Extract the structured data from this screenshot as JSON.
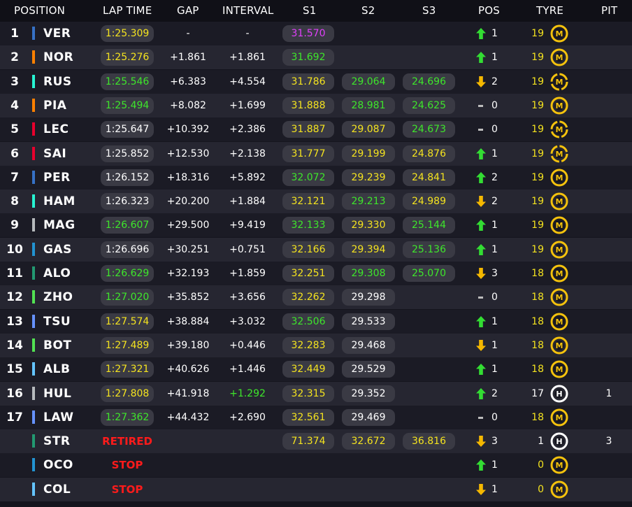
{
  "colors": {
    "purple": "#e040fb",
    "green": "#3ee62b",
    "yellow": "#f4e31f",
    "white": "#ffffff",
    "retired": "#ff1b1b",
    "arrow_up": "#33dd33",
    "arrow_down": "#f5b800",
    "tyre_medium": "#f4c20d",
    "tyre_hard": "#ffffff"
  },
  "headers": {
    "position": "POSITION",
    "lap_time": "LAP TIME",
    "gap": "GAP",
    "interval": "INTERVAL",
    "s1": "S1",
    "s2": "S2",
    "s3": "S3",
    "pos": "POS",
    "tyre": "TYRE",
    "pit": "PIT"
  },
  "drivers": [
    {
      "position": "1",
      "code": "VER",
      "team_color": "#3671c6",
      "lap_time": "1:25.309",
      "lap_color": "yellow",
      "gap": "-",
      "interval": "-",
      "interval_color": "white",
      "s1": "31.570",
      "s1_color": "purple",
      "s2": "",
      "s2_color": "white",
      "s3": "",
      "s3_color": "white",
      "status": "",
      "pos_change": "up",
      "pos_value": "1",
      "tyre_laps": "19",
      "tyre_laps_color": "yellow",
      "tyre": "M",
      "tyre_icon": "medium-tyre-icon",
      "pit": ""
    },
    {
      "position": "2",
      "code": "NOR",
      "team_color": "#ff8000",
      "lap_time": "1:25.276",
      "lap_color": "yellow",
      "gap": "+1.861",
      "interval": "+1.861",
      "interval_color": "white",
      "s1": "31.692",
      "s1_color": "green",
      "s2": "",
      "s2_color": "white",
      "s3": "",
      "s3_color": "white",
      "status": "",
      "pos_change": "up",
      "pos_value": "1",
      "tyre_laps": "19",
      "tyre_laps_color": "yellow",
      "tyre": "M",
      "tyre_icon": "medium-tyre-icon",
      "pit": ""
    },
    {
      "position": "3",
      "code": "RUS",
      "team_color": "#27f4d2",
      "lap_time": "1:25.546",
      "lap_color": "green",
      "gap": "+6.383",
      "interval": "+4.554",
      "interval_color": "white",
      "s1": "31.786",
      "s1_color": "yellow",
      "s2": "29.064",
      "s2_color": "green",
      "s3": "24.696",
      "s3_color": "green",
      "status": "",
      "pos_change": "down",
      "pos_value": "2",
      "tyre_laps": "19",
      "tyre_laps_color": "yellow",
      "tyre": "M",
      "tyre_icon": "medium-tyre-pitting-icon",
      "pit": ""
    },
    {
      "position": "4",
      "code": "PIA",
      "team_color": "#ff8000",
      "lap_time": "1:25.494",
      "lap_color": "green",
      "gap": "+8.082",
      "interval": "+1.699",
      "interval_color": "white",
      "s1": "31.888",
      "s1_color": "yellow",
      "s2": "28.981",
      "s2_color": "green",
      "s3": "24.625",
      "s3_color": "green",
      "status": "",
      "pos_change": "none",
      "pos_value": "0",
      "tyre_laps": "19",
      "tyre_laps_color": "yellow",
      "tyre": "M",
      "tyre_icon": "medium-tyre-icon",
      "pit": ""
    },
    {
      "position": "5",
      "code": "LEC",
      "team_color": "#e8002d",
      "lap_time": "1:25.647",
      "lap_color": "white",
      "gap": "+10.392",
      "interval": "+2.386",
      "interval_color": "white",
      "s1": "31.887",
      "s1_color": "yellow",
      "s2": "29.087",
      "s2_color": "yellow",
      "s3": "24.673",
      "s3_color": "green",
      "status": "",
      "pos_change": "none",
      "pos_value": "0",
      "tyre_laps": "19",
      "tyre_laps_color": "yellow",
      "tyre": "M",
      "tyre_icon": "medium-tyre-pitting-icon",
      "pit": ""
    },
    {
      "position": "6",
      "code": "SAI",
      "team_color": "#e8002d",
      "lap_time": "1:25.852",
      "lap_color": "white",
      "gap": "+12.530",
      "interval": "+2.138",
      "interval_color": "white",
      "s1": "31.777",
      "s1_color": "yellow",
      "s2": "29.199",
      "s2_color": "yellow",
      "s3": "24.876",
      "s3_color": "yellow",
      "status": "",
      "pos_change": "up",
      "pos_value": "1",
      "tyre_laps": "19",
      "tyre_laps_color": "yellow",
      "tyre": "M",
      "tyre_icon": "medium-tyre-pitting-icon",
      "pit": ""
    },
    {
      "position": "7",
      "code": "PER",
      "team_color": "#3671c6",
      "lap_time": "1:26.152",
      "lap_color": "white",
      "gap": "+18.316",
      "interval": "+5.892",
      "interval_color": "white",
      "s1": "32.072",
      "s1_color": "green",
      "s2": "29.239",
      "s2_color": "yellow",
      "s3": "24.841",
      "s3_color": "yellow",
      "status": "",
      "pos_change": "up",
      "pos_value": "2",
      "tyre_laps": "19",
      "tyre_laps_color": "yellow",
      "tyre": "M",
      "tyre_icon": "medium-tyre-icon",
      "pit": ""
    },
    {
      "position": "8",
      "code": "HAM",
      "team_color": "#27f4d2",
      "lap_time": "1:26.323",
      "lap_color": "white",
      "gap": "+20.200",
      "interval": "+1.884",
      "interval_color": "white",
      "s1": "32.121",
      "s1_color": "yellow",
      "s2": "29.213",
      "s2_color": "green",
      "s3": "24.989",
      "s3_color": "yellow",
      "status": "",
      "pos_change": "down",
      "pos_value": "2",
      "tyre_laps": "19",
      "tyre_laps_color": "yellow",
      "tyre": "M",
      "tyre_icon": "medium-tyre-icon",
      "pit": ""
    },
    {
      "position": "9",
      "code": "MAG",
      "team_color": "#b6babd",
      "lap_time": "1:26.607",
      "lap_color": "green",
      "gap": "+29.500",
      "interval": "+9.419",
      "interval_color": "white",
      "s1": "32.133",
      "s1_color": "green",
      "s2": "29.330",
      "s2_color": "yellow",
      "s3": "25.144",
      "s3_color": "green",
      "status": "",
      "pos_change": "up",
      "pos_value": "1",
      "tyre_laps": "19",
      "tyre_laps_color": "yellow",
      "tyre": "M",
      "tyre_icon": "medium-tyre-icon",
      "pit": ""
    },
    {
      "position": "10",
      "code": "GAS",
      "team_color": "#2293d1",
      "lap_time": "1:26.696",
      "lap_color": "white",
      "gap": "+30.251",
      "interval": "+0.751",
      "interval_color": "white",
      "s1": "32.166",
      "s1_color": "yellow",
      "s2": "29.394",
      "s2_color": "yellow",
      "s3": "25.136",
      "s3_color": "green",
      "status": "",
      "pos_change": "up",
      "pos_value": "1",
      "tyre_laps": "19",
      "tyre_laps_color": "yellow",
      "tyre": "M",
      "tyre_icon": "medium-tyre-icon",
      "pit": ""
    },
    {
      "position": "11",
      "code": "ALO",
      "team_color": "#229971",
      "lap_time": "1:26.629",
      "lap_color": "green",
      "gap": "+32.193",
      "interval": "+1.859",
      "interval_color": "white",
      "s1": "32.251",
      "s1_color": "yellow",
      "s2": "29.308",
      "s2_color": "green",
      "s3": "25.070",
      "s3_color": "green",
      "status": "",
      "pos_change": "down",
      "pos_value": "3",
      "tyre_laps": "18",
      "tyre_laps_color": "yellow",
      "tyre": "M",
      "tyre_icon": "medium-tyre-icon",
      "pit": ""
    },
    {
      "position": "12",
      "code": "ZHO",
      "team_color": "#52e252",
      "lap_time": "1:27.020",
      "lap_color": "green",
      "gap": "+35.852",
      "interval": "+3.656",
      "interval_color": "white",
      "s1": "32.262",
      "s1_color": "yellow",
      "s2": "29.298",
      "s2_color": "white",
      "s3": "",
      "s3_color": "white",
      "status": "",
      "pos_change": "none",
      "pos_value": "0",
      "tyre_laps": "18",
      "tyre_laps_color": "yellow",
      "tyre": "M",
      "tyre_icon": "medium-tyre-icon",
      "pit": ""
    },
    {
      "position": "13",
      "code": "TSU",
      "team_color": "#6692ff",
      "lap_time": "1:27.574",
      "lap_color": "yellow",
      "gap": "+38.884",
      "interval": "+3.032",
      "interval_color": "white",
      "s1": "32.506",
      "s1_color": "green",
      "s2": "29.533",
      "s2_color": "white",
      "s3": "",
      "s3_color": "white",
      "status": "",
      "pos_change": "up",
      "pos_value": "1",
      "tyre_laps": "18",
      "tyre_laps_color": "yellow",
      "tyre": "M",
      "tyre_icon": "medium-tyre-icon",
      "pit": ""
    },
    {
      "position": "14",
      "code": "BOT",
      "team_color": "#52e252",
      "lap_time": "1:27.489",
      "lap_color": "yellow",
      "gap": "+39.180",
      "interval": "+0.446",
      "interval_color": "white",
      "s1": "32.283",
      "s1_color": "yellow",
      "s2": "29.468",
      "s2_color": "white",
      "s3": "",
      "s3_color": "white",
      "status": "",
      "pos_change": "down",
      "pos_value": "1",
      "tyre_laps": "18",
      "tyre_laps_color": "yellow",
      "tyre": "M",
      "tyre_icon": "medium-tyre-icon",
      "pit": ""
    },
    {
      "position": "15",
      "code": "ALB",
      "team_color": "#64c4ff",
      "lap_time": "1:27.321",
      "lap_color": "yellow",
      "gap": "+40.626",
      "interval": "+1.446",
      "interval_color": "white",
      "s1": "32.449",
      "s1_color": "yellow",
      "s2": "29.529",
      "s2_color": "white",
      "s3": "",
      "s3_color": "white",
      "status": "",
      "pos_change": "up",
      "pos_value": "1",
      "tyre_laps": "18",
      "tyre_laps_color": "yellow",
      "tyre": "M",
      "tyre_icon": "medium-tyre-icon",
      "pit": ""
    },
    {
      "position": "16",
      "code": "HUL",
      "team_color": "#b6babd",
      "lap_time": "1:27.808",
      "lap_color": "yellow",
      "gap": "+41.918",
      "interval": "+1.292",
      "interval_color": "green",
      "s1": "32.315",
      "s1_color": "yellow",
      "s2": "29.352",
      "s2_color": "white",
      "s3": "",
      "s3_color": "white",
      "status": "",
      "pos_change": "up",
      "pos_value": "2",
      "tyre_laps": "17",
      "tyre_laps_color": "white",
      "tyre": "H",
      "tyre_icon": "hard-tyre-icon",
      "pit": "1"
    },
    {
      "position": "17",
      "code": "LAW",
      "team_color": "#6692ff",
      "lap_time": "1:27.362",
      "lap_color": "green",
      "gap": "+44.432",
      "interval": "+2.690",
      "interval_color": "white",
      "s1": "32.561",
      "s1_color": "yellow",
      "s2": "29.469",
      "s2_color": "white",
      "s3": "",
      "s3_color": "white",
      "status": "",
      "pos_change": "none",
      "pos_value": "0",
      "tyre_laps": "18",
      "tyre_laps_color": "yellow",
      "tyre": "M",
      "tyre_icon": "medium-tyre-icon",
      "pit": ""
    },
    {
      "position": "",
      "code": "STR",
      "team_color": "#229971",
      "lap_time": "",
      "lap_color": "white",
      "gap": "",
      "interval": "",
      "interval_color": "white",
      "s1": "71.374",
      "s1_color": "yellow",
      "s2": "32.672",
      "s2_color": "yellow",
      "s3": "36.816",
      "s3_color": "yellow",
      "status": "RETIRED",
      "pos_change": "down",
      "pos_value": "3",
      "tyre_laps": "1",
      "tyre_laps_color": "white",
      "tyre": "H",
      "tyre_icon": "hard-tyre-icon",
      "pit": "3"
    },
    {
      "position": "",
      "code": "OCO",
      "team_color": "#2293d1",
      "lap_time": "",
      "lap_color": "white",
      "gap": "",
      "interval": "",
      "interval_color": "white",
      "s1": "",
      "s1_color": "white",
      "s2": "",
      "s2_color": "white",
      "s3": "",
      "s3_color": "white",
      "status": "STOP",
      "pos_change": "up",
      "pos_value": "1",
      "tyre_laps": "0",
      "tyre_laps_color": "yellow",
      "tyre": "M",
      "tyre_icon": "medium-tyre-icon",
      "pit": ""
    },
    {
      "position": "",
      "code": "COL",
      "team_color": "#64c4ff",
      "lap_time": "",
      "lap_color": "white",
      "gap": "",
      "interval": "",
      "interval_color": "white",
      "s1": "",
      "s1_color": "white",
      "s2": "",
      "s2_color": "white",
      "s3": "",
      "s3_color": "white",
      "status": "STOP",
      "pos_change": "down",
      "pos_value": "1",
      "tyre_laps": "0",
      "tyre_laps_color": "yellow",
      "tyre": "M",
      "tyre_icon": "medium-tyre-icon",
      "pit": ""
    }
  ]
}
